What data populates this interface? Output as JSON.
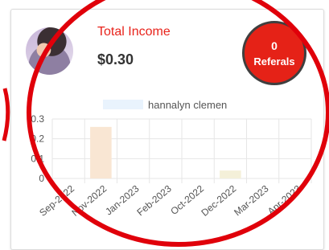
{
  "card": {
    "title": "Total Income",
    "amount": "$0.30",
    "referrals": {
      "count": "0",
      "label": "Referals"
    }
  },
  "colors": {
    "accent": "#e8231b",
    "badge": "#e52217",
    "annotation": "#e0000a"
  },
  "chart_data": {
    "type": "bar",
    "categories": [
      "Sep-2022",
      "Nov-2022",
      "Jan-2023",
      "Feb-2023",
      "Oct-2022",
      "Dec-2022",
      "Mar-2023",
      "Apr-2023"
    ],
    "series": [
      {
        "name": "hannalyn clemen",
        "values": [
          0,
          0.26,
          0,
          0,
          0,
          0.04,
          0,
          0
        ]
      }
    ],
    "bar_colors": [
      "#f9e6d3",
      "#f9e6d3",
      "#f9e6d3",
      "#f9e6d3",
      "#f9e6d3",
      "#f4f0d9",
      "#f9e6d3",
      "#f9e6d3"
    ],
    "legend_color": "#e9f3fd",
    "ylim": [
      0,
      0.3
    ],
    "yticks": [
      "0",
      "0.1",
      "0.2",
      "0.3"
    ],
    "legend": "top",
    "grid": true
  }
}
